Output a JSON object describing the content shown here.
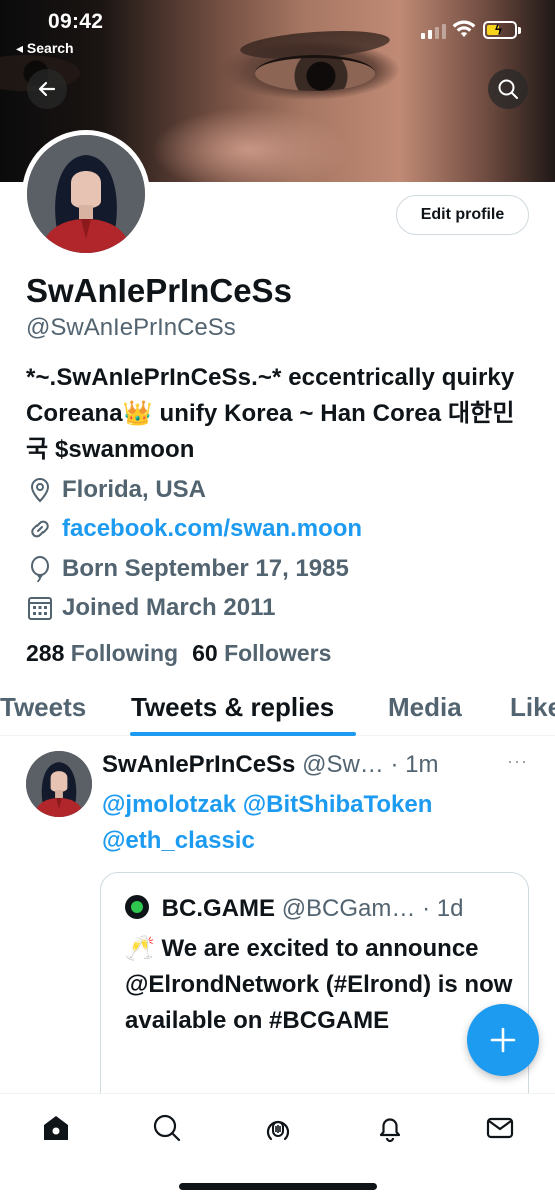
{
  "status_bar": {
    "time": "09:42",
    "back_label": "◂ Search"
  },
  "profile": {
    "display_name": "SwAnIePrInCeSs",
    "handle": "@SwAnIePrInCeSs",
    "edit_profile_label": "Edit profile",
    "bio": "*~.SwAnIePrInCeSs.~* eccentrically quirky Coreana👑 unify Korea ~ Han Corea 대한민국 $swanmoon",
    "location": "Florida, USA",
    "website": "facebook.com/swan.moon",
    "birthday": "Born September 17, 1985",
    "joined": "Joined March 2011",
    "following_count": "288",
    "following_label": "Following",
    "followers_count": "60",
    "followers_label": "Followers"
  },
  "tabs": [
    {
      "label": "Tweets",
      "active": false
    },
    {
      "label": "Tweets & replies",
      "active": true
    },
    {
      "label": "Media",
      "active": false
    },
    {
      "label": "Likes",
      "active": false
    }
  ],
  "tweet": {
    "author_name": "SwAnIePrInCeSs",
    "author_handle_meta": "@Sw… · 1m",
    "more": "···",
    "text": "@jmolotzak @BitShibaToken @eth_classic",
    "quote": {
      "author_name": "BC.GAME",
      "author_handle_meta": "@BCGam… · 1d",
      "text": "🥂 We are excited to announce @ElrondNetwork (#Elrond) is now available on #BCGAME"
    }
  },
  "colors": {
    "accent": "#1d9bf0",
    "text_primary": "#0f1419",
    "text_secondary": "#536471",
    "border": "#cfd9de"
  },
  "icons": {
    "back": "arrow-left-icon",
    "search": "search-icon",
    "location": "map-pin-icon",
    "link": "link-icon",
    "birthday": "balloon-icon",
    "joined": "calendar-icon",
    "compose": "plus-icon",
    "nav": [
      "home-icon",
      "search-icon",
      "spaces-icon",
      "bell-icon",
      "mail-icon"
    ]
  }
}
